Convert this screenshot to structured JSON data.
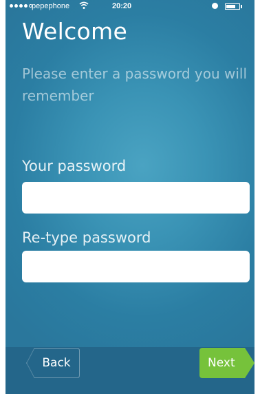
{
  "status_bar": {
    "carrier": "pepephone",
    "time": "20:20",
    "signal_bars_filled": 4,
    "signal_bars_total": 5,
    "wifi_icon": "wifi-icon",
    "alarm_icon": "alarm-icon",
    "battery_icon": "battery-icon",
    "battery_level": 0.7
  },
  "header": {
    "title": "Welcome",
    "subtitle": "Please enter a password you will remember"
  },
  "form": {
    "password_label": "Your password",
    "password_value": "",
    "retype_label": "Re-type password",
    "retype_value": ""
  },
  "navigation": {
    "back_label": "Back",
    "next_label": "Next"
  },
  "colors": {
    "background": "#3a93b5",
    "bottom_bar": "#24668a",
    "next_button": "#76c23b",
    "text": "#ffffff"
  }
}
